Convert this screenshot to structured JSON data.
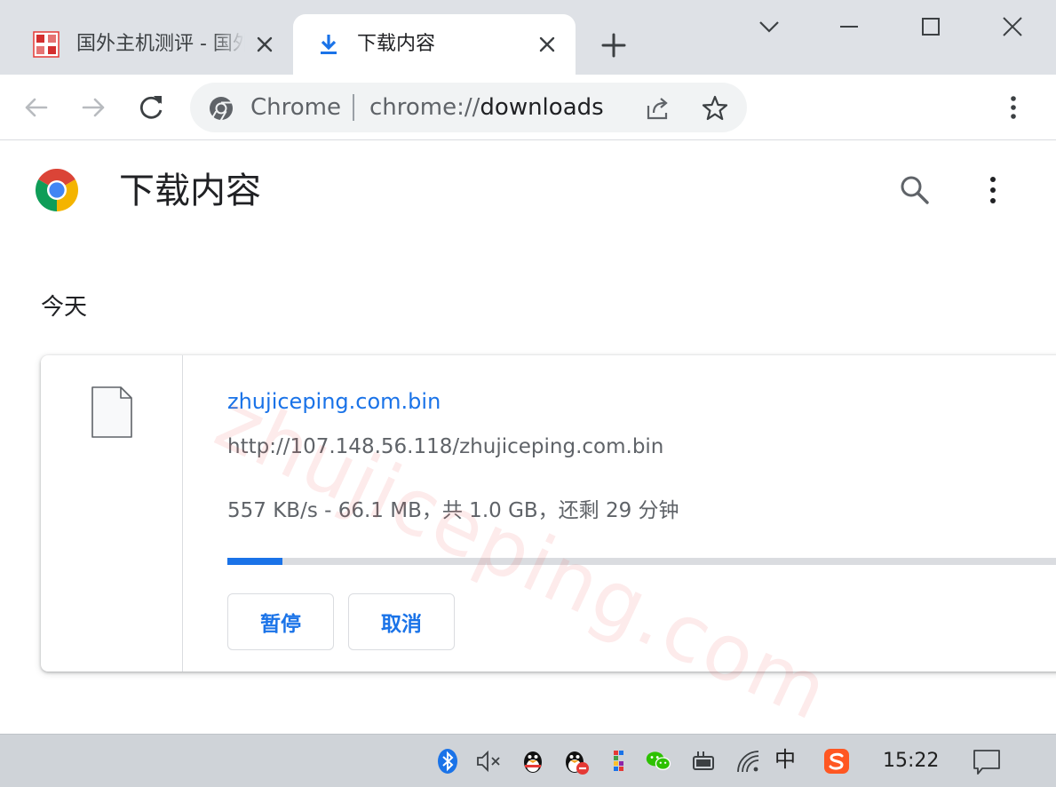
{
  "tabs": [
    {
      "title": "国外主机测评 - 国外VPS，国外",
      "active": false
    },
    {
      "title": "下载内容",
      "active": true
    }
  ],
  "omnibox": {
    "chip": "Chrome",
    "url_scheme": "chrome://",
    "url_host": "downloads"
  },
  "page": {
    "title": "下载内容",
    "date_header": "今天"
  },
  "download": {
    "file_name": "zhujiceping.com.bin",
    "url": "http://107.148.56.118/zhujiceping.com.bin",
    "status": "557 KB/s - 66.1 MB，共 1.0 GB，还剩 29 分钟",
    "progress_fraction": 0.0646,
    "pause_label": "暂停",
    "cancel_label": "取消"
  },
  "watermark": "zhujiceping.com",
  "taskbar": {
    "ime": "中",
    "clock": "15:22"
  },
  "colors": {
    "accent": "#1a73e8",
    "tabstrip": "#dee1e6",
    "taskbar": "#cfd3d8"
  }
}
